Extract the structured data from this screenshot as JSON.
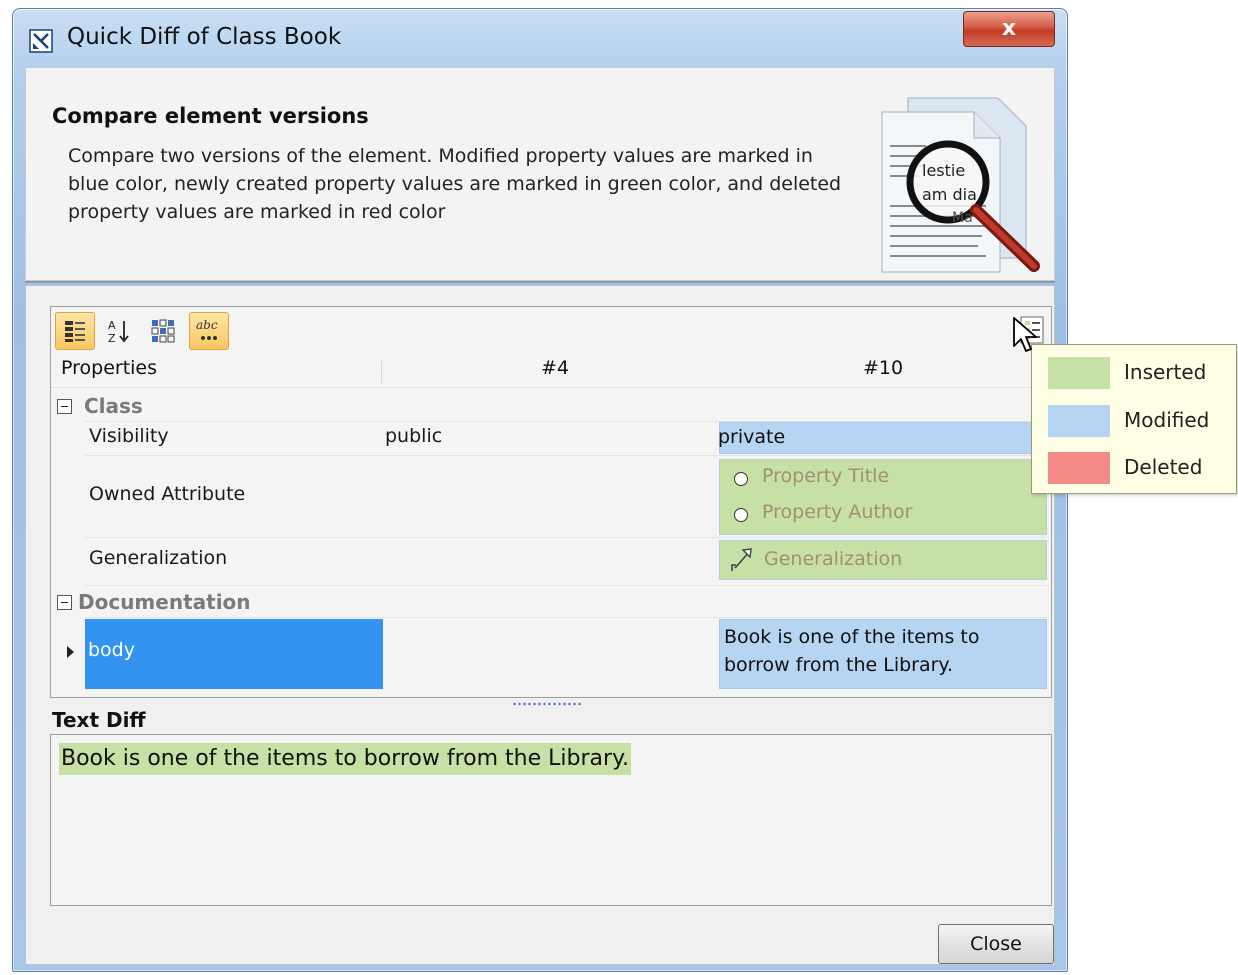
{
  "window": {
    "title": "Quick Diff of Class Book",
    "close_glyph": "x"
  },
  "header": {
    "title": "Compare element versions",
    "description": "Compare two versions of the element. Modified property values are marked in blue color, newly created property values are marked in green color, and deleted property values are marked in red color",
    "art_text": {
      "line1": "lestie",
      "line2": "am dia",
      "line3": "Ma"
    }
  },
  "toolbar": {
    "buttons": [
      {
        "icon": "categorized-view-icon",
        "active": true
      },
      {
        "icon": "sort-alphabetically-icon",
        "active": false
      },
      {
        "icon": "show-differences-icon",
        "active": false
      },
      {
        "icon": "text-diff-icon",
        "active": true
      }
    ],
    "legend_button_icon": "legend-icon"
  },
  "table": {
    "columns": [
      "Properties",
      "#4",
      "#10"
    ],
    "groups": [
      {
        "label": "Class",
        "rows": [
          {
            "name": "Visibility",
            "v4": "public",
            "v10": [
              "private"
            ],
            "status": "modified"
          },
          {
            "name": "Owned Attribute",
            "v4": "",
            "v10": [
              "Property Title",
              "Property Author"
            ],
            "status": "inserted"
          },
          {
            "name": "Generalization",
            "v4": "",
            "v10": [
              "Generalization"
            ],
            "status": "inserted"
          }
        ]
      },
      {
        "label": "Documentation",
        "rows": [
          {
            "name": "body",
            "v4": "",
            "v10": [
              "Book is one of the items to",
              "borrow from the Library."
            ],
            "status": "modified",
            "selected": true
          }
        ]
      }
    ]
  },
  "text_diff": {
    "label": "Text Diff",
    "text": "Book is one of the items to borrow from the Library.",
    "status": "inserted"
  },
  "buttons": {
    "close": "Close"
  },
  "legend": {
    "items": [
      {
        "label": "Inserted",
        "color": "#c6e0a6"
      },
      {
        "label": "Modified",
        "color": "#b6d5f2"
      },
      {
        "label": "Deleted",
        "color": "#f38b87"
      }
    ]
  },
  "colors": {
    "inserted": "#c6e0a6",
    "modified": "#b6d5f2",
    "deleted": "#f38b87",
    "selection": "#3394f0",
    "inserted_text": "#a38f73"
  }
}
